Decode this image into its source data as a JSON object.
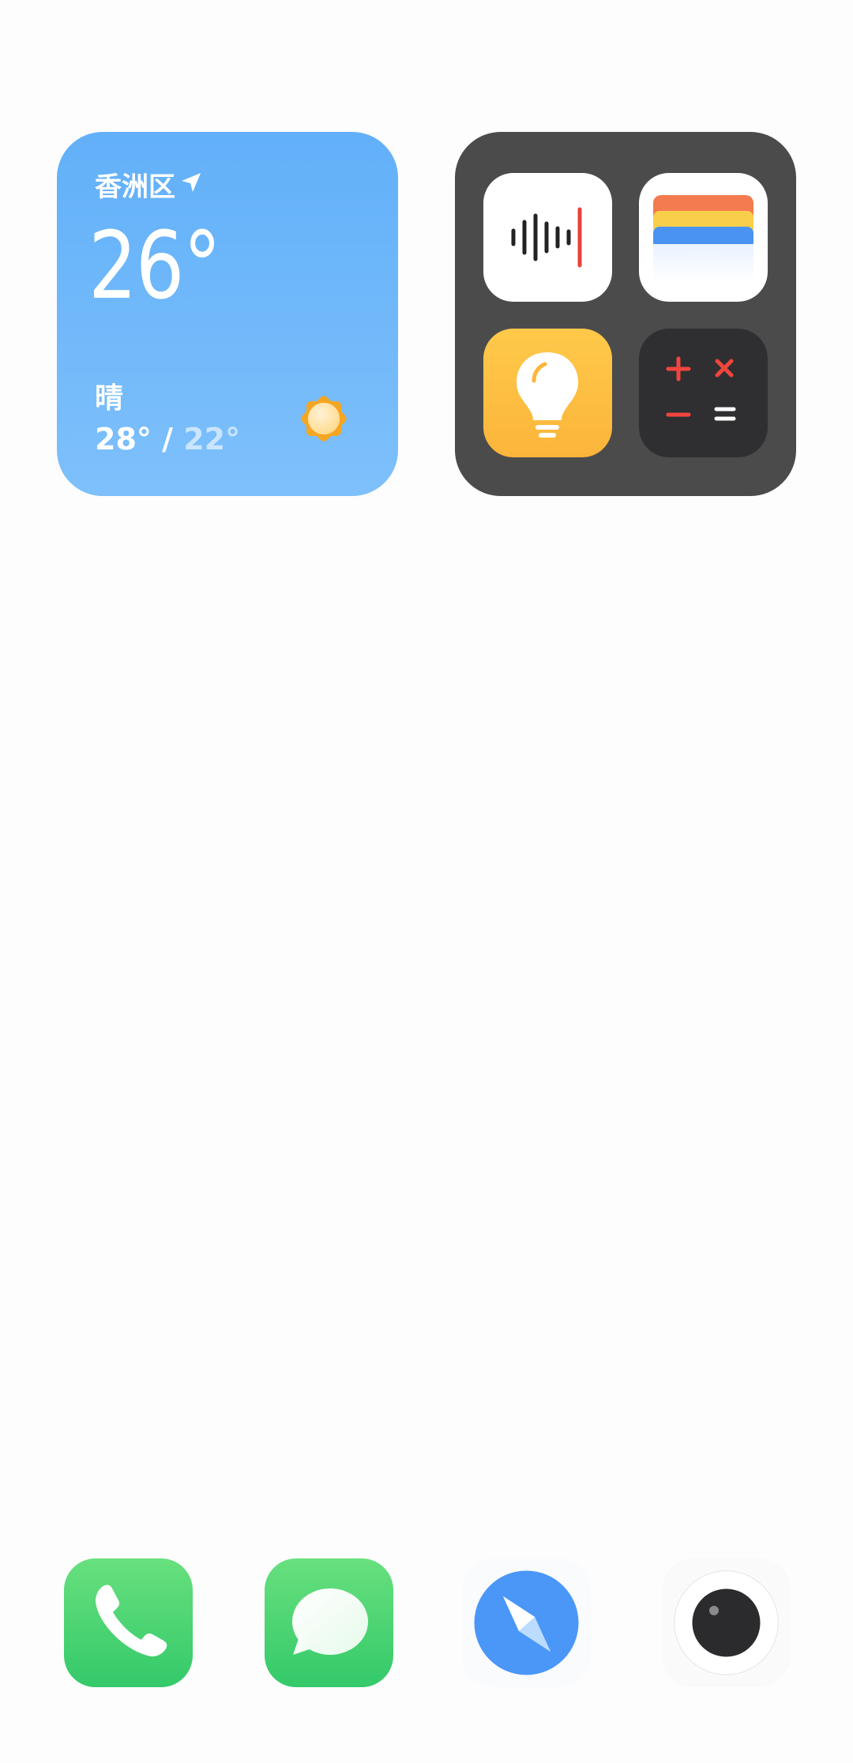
{
  "weather": {
    "location": "香洲区",
    "temperature": "26°",
    "condition": "晴",
    "high": "28°",
    "separator": " / ",
    "low": "22°",
    "icons": [
      "location-arrow-icon",
      "sun-icon"
    ]
  },
  "folder": {
    "apps": [
      {
        "icon": "voice-recorder-icon"
      },
      {
        "icon": "wallet-icon"
      },
      {
        "icon": "lightbulb-tips-icon"
      },
      {
        "icon": "calculator-icon"
      }
    ]
  },
  "dock": {
    "apps": [
      {
        "icon": "phone-icon"
      },
      {
        "icon": "messages-icon"
      },
      {
        "icon": "browser-compass-icon"
      },
      {
        "icon": "camera-icon"
      }
    ]
  },
  "colors": {
    "weather_top": "#62b0f9",
    "weather_bottom": "#7ec0fb",
    "folder_bg": "#4b4b4b",
    "dock_green": "#34c96a",
    "browser_blue": "#4a97f8"
  }
}
